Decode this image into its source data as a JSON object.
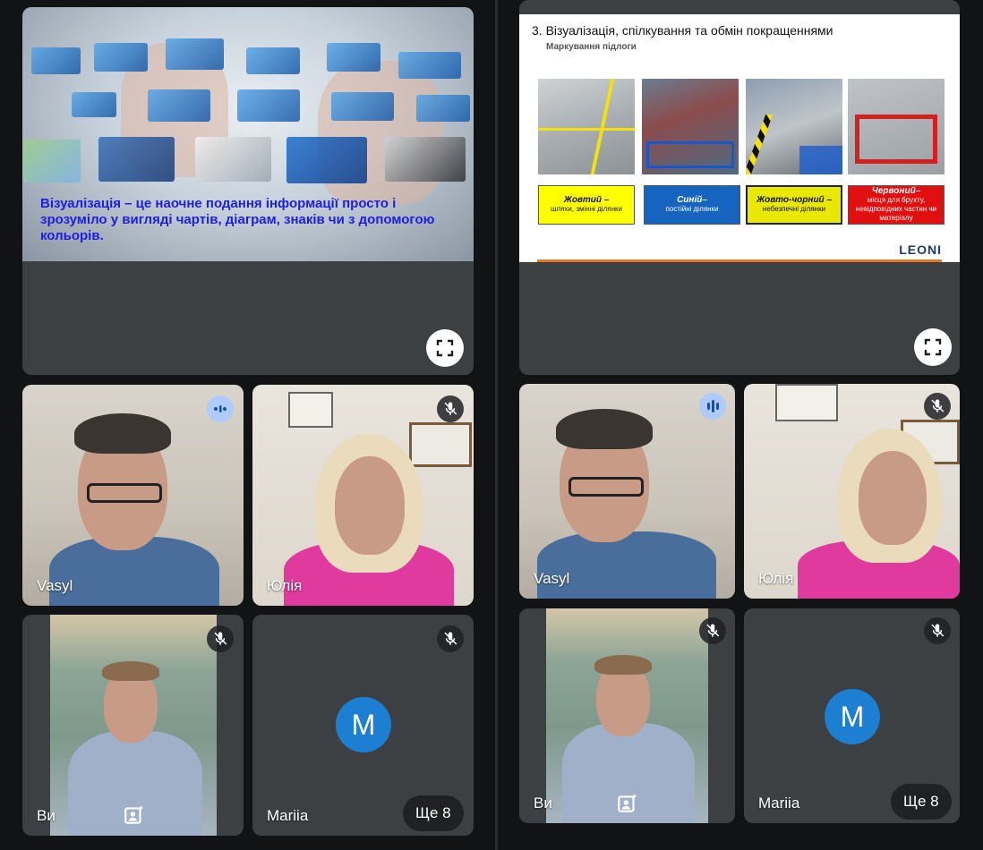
{
  "left_panel": {
    "slide_text": "Візуалізація – це наочне подання інформації просто і зрозуміло у вигляді чартів,  діаграм,  знаків чи з допомогою кольорів.",
    "participants": [
      {
        "name": "Vasyl",
        "status": "speaking"
      },
      {
        "name": "Юлія",
        "status": "muted"
      },
      {
        "name": "Ви",
        "status": "muted"
      },
      {
        "name": "Mariia",
        "status": "muted",
        "avatar_letter": "M"
      }
    ],
    "more_label": "Ще 8"
  },
  "right_panel": {
    "slide_title": "3.  Візуалізація, спілкування та обмін покращеннями",
    "slide_subtitle": "Маркування підлоги",
    "labels": [
      {
        "title": "Жовтий –",
        "desc": "шляхи, змінні ділянки",
        "bg": "#ffff00",
        "color": "#111"
      },
      {
        "title": "Синій–",
        "desc": "постійні ділянки",
        "bg": "#1565c0",
        "color": "#fff"
      },
      {
        "title": "Жовто-чорний –",
        "desc": "небезпечні ділянки",
        "bg": "#e8e800",
        "color": "#111"
      },
      {
        "title": "Червоний–",
        "desc": "місця для брухту, невідповідних частин чи матеріалу",
        "bg": "#e01010",
        "color": "#fff"
      }
    ],
    "brand": "LEONI",
    "participants": [
      {
        "name": "Vasyl",
        "status": "speaking"
      },
      {
        "name": "Юлія",
        "status": "muted"
      },
      {
        "name": "Ви",
        "status": "muted"
      },
      {
        "name": "Mariia",
        "status": "muted",
        "avatar_letter": "M"
      }
    ],
    "more_label": "Ще 8"
  },
  "colors": {
    "tile_bg": "#3c4043",
    "avatar": "#1d7fd1",
    "speaking_badge": "#aecbfa"
  },
  "icons": [
    "mic-off-icon",
    "speaking-icon",
    "fullscreen-icon",
    "visual-effects-icon"
  ]
}
